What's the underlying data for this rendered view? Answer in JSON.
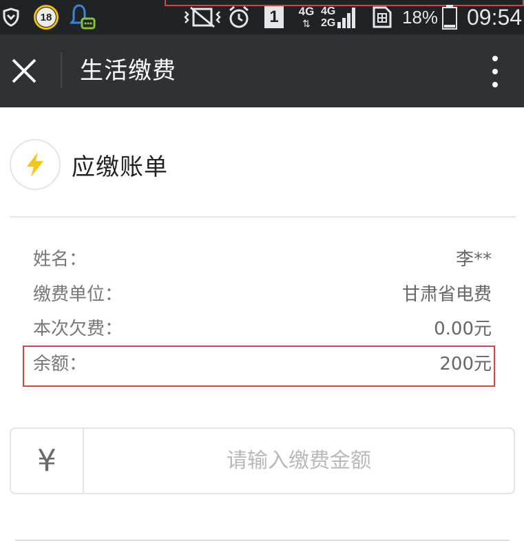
{
  "status_bar": {
    "notification_badge": "18",
    "network_type_1": "4G",
    "network_type_2": "4G",
    "network_type_3": "2G",
    "sim_slot": "1",
    "battery_percent": "18%",
    "clock": "09:54"
  },
  "title_bar": {
    "title": "生活缴费"
  },
  "bill": {
    "title": "应缴账单",
    "rows": [
      {
        "label": "姓名：",
        "value": "李**"
      },
      {
        "label": "缴费单位：",
        "value": "甘肃省电费"
      },
      {
        "label": "本次欠费：",
        "value": "0.00元"
      },
      {
        "label": "余额：",
        "value": "200元"
      }
    ]
  },
  "payment": {
    "currency_symbol": "¥",
    "amount_placeholder": "请输入缴费金额",
    "amount_value": ""
  },
  "colors": {
    "status_bar_bg": "#1f2326",
    "title_bar_bg": "#2e3235",
    "bolt": "#f5c518",
    "highlight": "#d64545"
  }
}
